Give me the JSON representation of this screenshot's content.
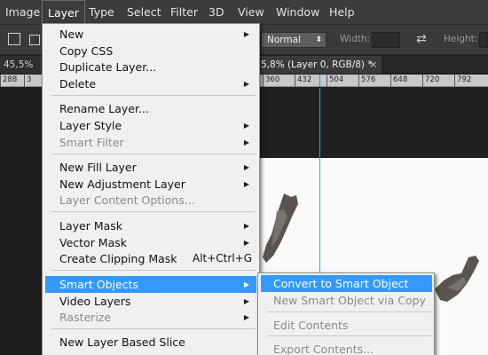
{
  "menubar": {
    "items": [
      "Image",
      "Layer",
      "Type",
      "Select",
      "Filter",
      "3D",
      "View",
      "Window",
      "Help"
    ]
  },
  "options_bar": {
    "blend_mode": "Normal",
    "width_label": "Width:",
    "height_label": "Height:"
  },
  "tabs": {
    "left_tab": "45,5% (L",
    "active_tab": "5,8% (Layer 0, RGB/8) *",
    "close_glyph": "×"
  },
  "ruler": {
    "labels": [
      "288",
      "3",
      "360",
      "432",
      "504",
      "576",
      "648",
      "720",
      "792"
    ]
  },
  "layer_menu": {
    "items": [
      {
        "label": "New",
        "submenu": true,
        "enabled": true
      },
      {
        "label": "Copy CSS",
        "submenu": false,
        "enabled": true
      },
      {
        "label": "Duplicate Layer...",
        "submenu": false,
        "enabled": true
      },
      {
        "label": "Delete",
        "submenu": true,
        "enabled": true
      },
      {
        "label": "Rename Layer...",
        "submenu": false,
        "enabled": true
      },
      {
        "label": "Layer Style",
        "submenu": true,
        "enabled": true
      },
      {
        "label": "Smart Filter",
        "submenu": true,
        "enabled": false
      },
      {
        "label": "New Fill Layer",
        "submenu": true,
        "enabled": true
      },
      {
        "label": "New Adjustment Layer",
        "submenu": true,
        "enabled": true
      },
      {
        "label": "Layer Content Options...",
        "submenu": false,
        "enabled": false
      },
      {
        "label": "Layer Mask",
        "submenu": true,
        "enabled": true
      },
      {
        "label": "Vector Mask",
        "submenu": true,
        "enabled": true
      },
      {
        "label": "Create Clipping Mask",
        "shortcut": "Alt+Ctrl+G",
        "submenu": false,
        "enabled": true
      },
      {
        "label": "Smart Objects",
        "submenu": true,
        "enabled": true,
        "highlighted": true
      },
      {
        "label": "Video Layers",
        "submenu": true,
        "enabled": true
      },
      {
        "label": "Rasterize",
        "submenu": true,
        "enabled": false
      },
      {
        "label": "New Layer Based Slice",
        "submenu": false,
        "enabled": true
      }
    ]
  },
  "smart_objects_submenu": {
    "items": [
      {
        "label": "Convert to Smart Object",
        "enabled": true,
        "highlighted": true
      },
      {
        "label": "New Smart Object via Copy",
        "enabled": false
      },
      {
        "label": "Edit Contents",
        "enabled": false
      },
      {
        "label": "Export Contents...",
        "enabled": false
      }
    ]
  },
  "colors": {
    "highlight": "#3399ff",
    "menu_bg": "#f0f0f0",
    "guide": "#2aa8dc"
  }
}
